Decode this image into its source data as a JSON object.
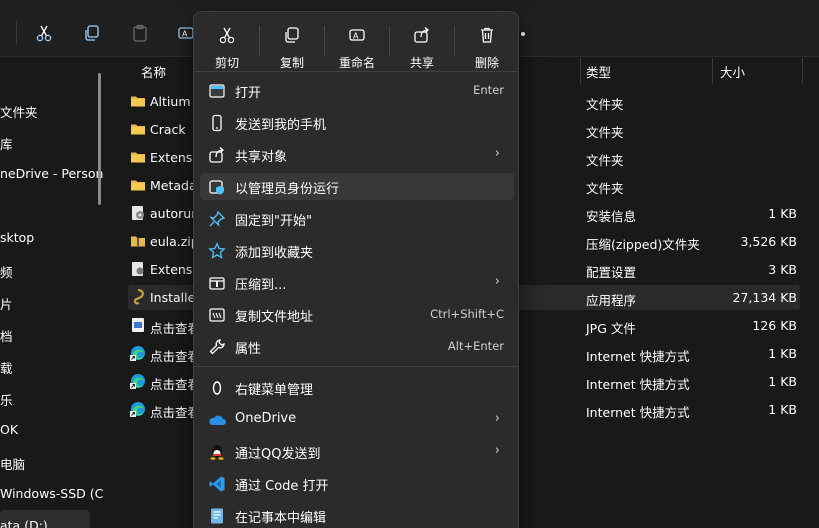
{
  "toolbar": {
    "icons": [
      "cut-icon",
      "copy-icon",
      "paste-icon",
      "rename-icon"
    ]
  },
  "sidebar": {
    "items": [
      {
        "label": "文件夹"
      },
      {
        "label": "库"
      },
      {
        "label": "neDrive - Person"
      },
      {
        "label": "sktop"
      },
      {
        "label": "频"
      },
      {
        "label": "片"
      },
      {
        "label": "档"
      },
      {
        "label": "载"
      },
      {
        "label": "乐"
      },
      {
        "label": "OK"
      },
      {
        "label": "电脑"
      },
      {
        "label": "Windows-SSD (C"
      },
      {
        "label": "ata (D:)"
      }
    ]
  },
  "columns": {
    "name": "名称",
    "type": "类型",
    "size": "大小"
  },
  "files": [
    {
      "name": "Altium",
      "type": "文件夹",
      "size": "",
      "icon": "folder-icon"
    },
    {
      "name": "Crack",
      "type": "文件夹",
      "size": "",
      "icon": "folder-icon"
    },
    {
      "name": "Extensio",
      "type": "文件夹",
      "size": "",
      "icon": "folder-icon"
    },
    {
      "name": "Metada",
      "type": "文件夹",
      "size": "",
      "icon": "folder-icon"
    },
    {
      "name": "autorun",
      "type": "安装信息",
      "size": "1 KB",
      "icon": "setup-info-icon"
    },
    {
      "name": "eula.zip",
      "type": "压缩(zipped)文件夹",
      "size": "3,526 KB",
      "icon": "zip-folder-icon"
    },
    {
      "name": "Extensio",
      "type": "配置设置",
      "size": "3 KB",
      "icon": "config-icon"
    },
    {
      "name": "Installe",
      "type": "应用程序",
      "size": "27,134 KB",
      "icon": "app-icon"
    },
    {
      "name": "点击查看",
      "type": "JPG 文件",
      "size": "126 KB",
      "icon": "image-file-icon"
    },
    {
      "name": "点击查看",
      "type": "Internet 快捷方式",
      "size": "1 KB",
      "icon": "edge-icon"
    },
    {
      "name": "点击查看",
      "type": "Internet 快捷方式",
      "size": "1 KB",
      "icon": "edge-icon"
    },
    {
      "name": "点击查看",
      "type": "Internet 快捷方式",
      "size": "1 KB",
      "icon": "edge-icon"
    }
  ],
  "menu": {
    "quick_actions": [
      {
        "label": "剪切",
        "icon": "cut-icon"
      },
      {
        "label": "复制",
        "icon": "copy-icon"
      },
      {
        "label": "重命名",
        "icon": "rename-icon"
      },
      {
        "label": "共享",
        "icon": "share-icon"
      },
      {
        "label": "删除",
        "icon": "delete-icon"
      }
    ],
    "items": [
      {
        "label": "打开",
        "shortcut": "Enter",
        "icon": "open-app-icon"
      },
      {
        "label": "发送到我的手机",
        "shortcut": "",
        "icon": "phone-icon"
      },
      {
        "label": "共享对象",
        "shortcut": "",
        "icon": "share-icon",
        "arrow": "›"
      },
      {
        "label": "以管理员身份运行",
        "shortcut": "",
        "icon": "admin-shield-icon"
      },
      {
        "label": "固定到\"开始\"",
        "shortcut": "",
        "icon": "pin-icon"
      },
      {
        "label": "添加到收藏夹",
        "shortcut": "",
        "icon": "star-icon"
      },
      {
        "label": "压缩到...",
        "shortcut": "",
        "icon": "zip-icon",
        "arrow": "›"
      },
      {
        "label": "复制文件地址",
        "shortcut": "Ctrl+Shift+C",
        "icon": "copy-path-icon"
      },
      {
        "label": "属性",
        "shortcut": "Alt+Enter",
        "icon": "wrench-icon"
      },
      {
        "label": "右键菜单管理",
        "shortcut": "",
        "icon": "menu-manager-icon"
      },
      {
        "label": "OneDrive",
        "shortcut": "",
        "icon": "onedrive-icon",
        "arrow": "›"
      },
      {
        "label": "通过QQ发送到",
        "shortcut": "",
        "icon": "qq-icon",
        "arrow": "›"
      },
      {
        "label": "通过 Code 打开",
        "shortcut": "",
        "icon": "vscode-icon"
      },
      {
        "label": "在记事本中编辑",
        "shortcut": "",
        "icon": "notepad-icon"
      }
    ]
  },
  "colors": {
    "background": "#191919",
    "menu": "#2b2b2b",
    "hover": "#383838",
    "accent": "#4cc2ff",
    "folder": "#e9b84a"
  }
}
